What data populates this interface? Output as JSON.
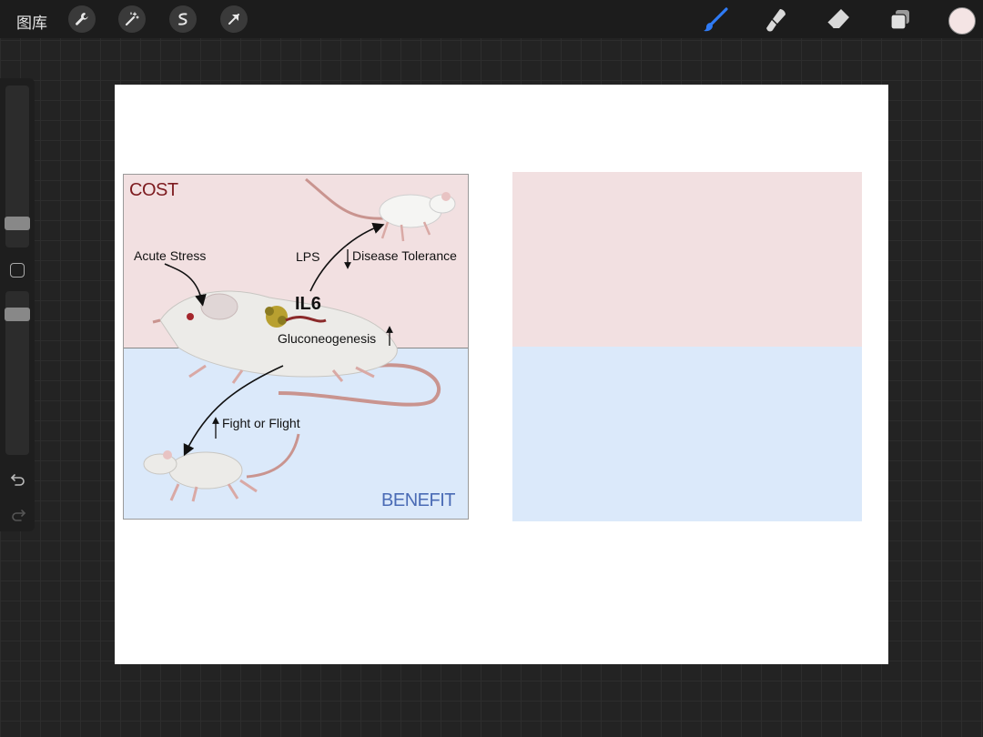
{
  "toolbar": {
    "gallery_label": "图库",
    "left_tools": [
      "wrench-icon",
      "magic-wand-icon",
      "selection-icon",
      "transform-arrow-icon"
    ],
    "right_tools": [
      "brush-icon",
      "smudge-icon",
      "eraser-icon",
      "layers-icon"
    ],
    "active_tool": "brush-icon",
    "accent_color": "#2f7bf5",
    "current_color": "#f4e4e4"
  },
  "sidebar": {
    "items": [
      "brush-size-slider",
      "modify-button",
      "opacity-slider",
      "undo-icon",
      "redo-icon"
    ]
  },
  "diagram": {
    "cost_label": "COST",
    "benefit_label": "BENEFIT",
    "acute_stress": "Acute Stress",
    "lps": "LPS",
    "disease_tolerance": "Disease Tolerance",
    "il6": "IL6",
    "gluconeogenesis": "Gluconeogenesis",
    "fight_or_flight": "Fight or Flight",
    "cost_color": "#f2e0e1",
    "benefit_color": "#dbe9fa"
  }
}
